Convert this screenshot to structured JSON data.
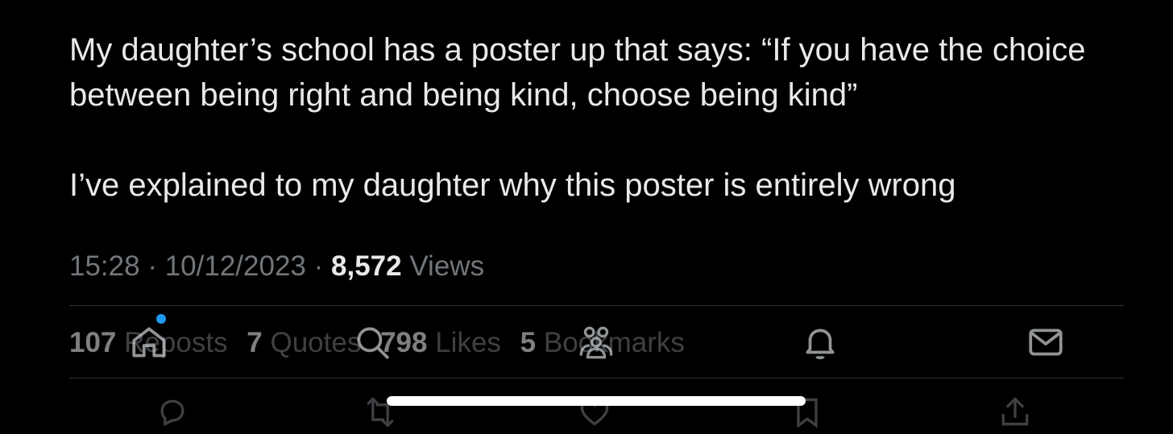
{
  "tweet": {
    "paragraph_1": "My daughter’s school has a poster up that says: “If you have the choice between being right and being kind, choose being kind”",
    "paragraph_2": "I’ve explained to my daughter why this poster is entirely wrong"
  },
  "meta": {
    "time": "15:28",
    "separator": "·",
    "date": "10/12/2023",
    "views_count": "8,572",
    "views_label": "Views"
  },
  "stats": {
    "reposts_count": "107",
    "reposts_label": "Reposts",
    "quotes_count": "7",
    "quotes_label": "Quotes",
    "likes_count": "798",
    "likes_label": "Likes",
    "bookmarks_count": "5",
    "bookmarks_label": "Bookmarks"
  },
  "navbar": {
    "items": [
      {
        "icon": "home-icon"
      },
      {
        "icon": "search-icon"
      },
      {
        "icon": "communities-icon"
      },
      {
        "icon": "notifications-icon"
      },
      {
        "icon": "messages-icon"
      }
    ],
    "home_has_notification_dot": true,
    "dot_color": "#1d9bf0"
  },
  "actions": [
    {
      "icon": "reply-icon"
    },
    {
      "icon": "retweet-icon"
    },
    {
      "icon": "like-icon"
    },
    {
      "icon": "bookmark-icon"
    },
    {
      "icon": "share-icon"
    }
  ],
  "colors": {
    "background": "#000000",
    "primary_text": "#e7e9ea",
    "secondary_text": "#71767b",
    "divider": "#2f3336",
    "accent": "#1d9bf0"
  }
}
